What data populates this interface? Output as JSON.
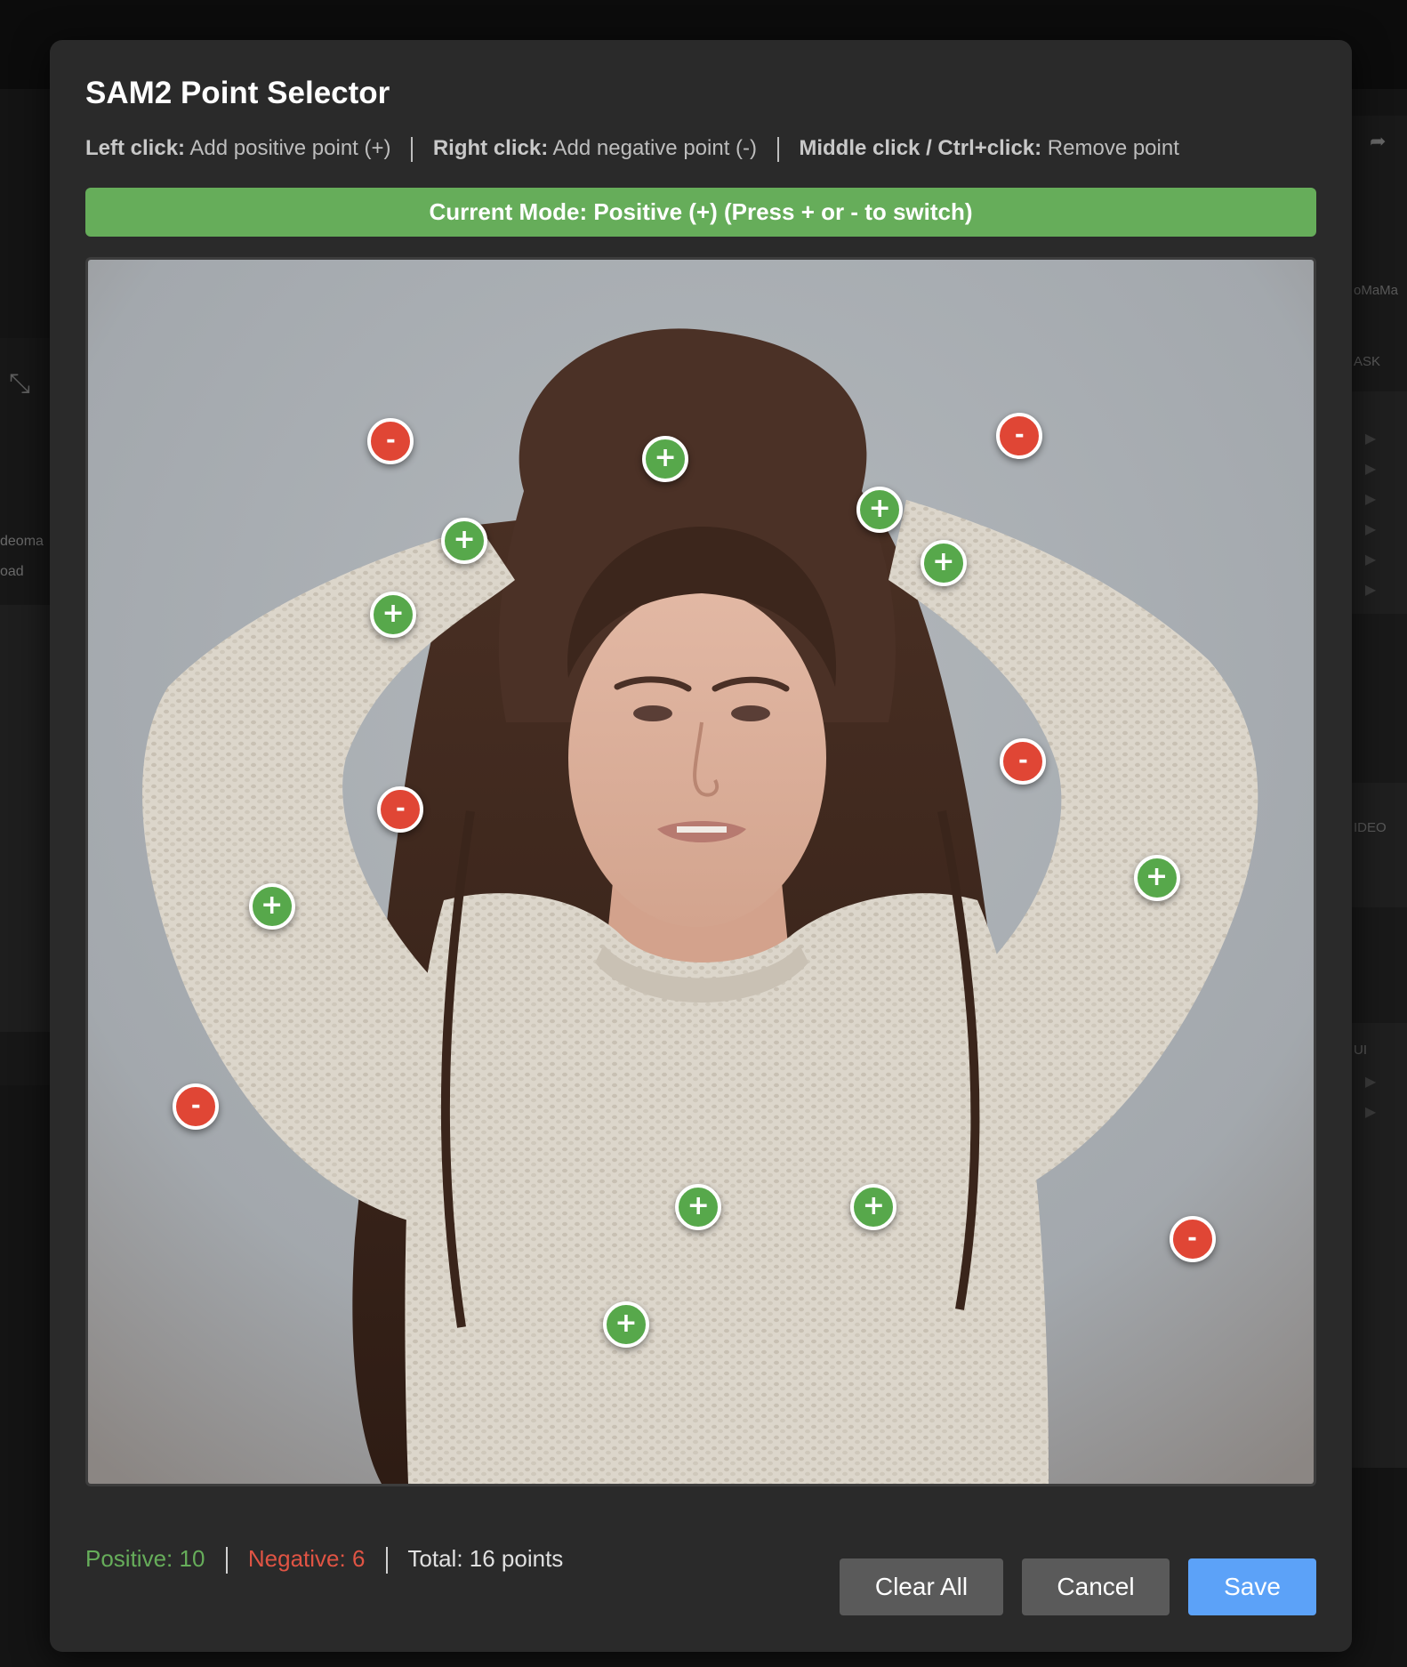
{
  "background_app": {
    "left_texts": [
      "deoma",
      "oad"
    ],
    "right_texts": [
      "oMaMa",
      "ASK",
      "IDEO",
      "UI"
    ]
  },
  "modal": {
    "title": "SAM2 Point Selector",
    "instructions": [
      {
        "key": "Left click:",
        "action": "Add positive point (+)"
      },
      {
        "key": "Right click:",
        "action": "Add negative point (-)"
      },
      {
        "key": "Middle click / Ctrl+click:",
        "action": "Remove point"
      }
    ],
    "mode_bar": "Current Mode: Positive (+) (Press + or - to switch)",
    "colors": {
      "positive": "#57a84b",
      "negative": "#e04635",
      "mode_bar": "#66ad5a",
      "save": "#5ca2f8"
    },
    "points": [
      {
        "type": "neg",
        "symbol": "-",
        "x": 0.247,
        "y": 0.148
      },
      {
        "type": "pos",
        "symbol": "+",
        "x": 0.471,
        "y": 0.163
      },
      {
        "type": "neg",
        "symbol": "-",
        "x": 0.76,
        "y": 0.144
      },
      {
        "type": "pos",
        "symbol": "+",
        "x": 0.307,
        "y": 0.23
      },
      {
        "type": "pos",
        "symbol": "+",
        "x": 0.646,
        "y": 0.204
      },
      {
        "type": "pos",
        "symbol": "+",
        "x": 0.698,
        "y": 0.248
      },
      {
        "type": "pos",
        "symbol": "+",
        "x": 0.249,
        "y": 0.29
      },
      {
        "type": "neg",
        "symbol": "-",
        "x": 0.763,
        "y": 0.41
      },
      {
        "type": "neg",
        "symbol": "-",
        "x": 0.255,
        "y": 0.449
      },
      {
        "type": "pos",
        "symbol": "+",
        "x": 0.15,
        "y": 0.528
      },
      {
        "type": "pos",
        "symbol": "+",
        "x": 0.872,
        "y": 0.505
      },
      {
        "type": "neg",
        "symbol": "-",
        "x": 0.088,
        "y": 0.692
      },
      {
        "type": "pos",
        "symbol": "+",
        "x": 0.498,
        "y": 0.774
      },
      {
        "type": "pos",
        "symbol": "+",
        "x": 0.641,
        "y": 0.774
      },
      {
        "type": "neg",
        "symbol": "-",
        "x": 0.901,
        "y": 0.8
      },
      {
        "type": "pos",
        "symbol": "+",
        "x": 0.439,
        "y": 0.87
      }
    ],
    "stats": {
      "positive": "Positive: 10",
      "negative": "Negative: 6",
      "total": "Total: 16 points"
    },
    "buttons": {
      "clear": "Clear All",
      "cancel": "Cancel",
      "save": "Save"
    }
  }
}
